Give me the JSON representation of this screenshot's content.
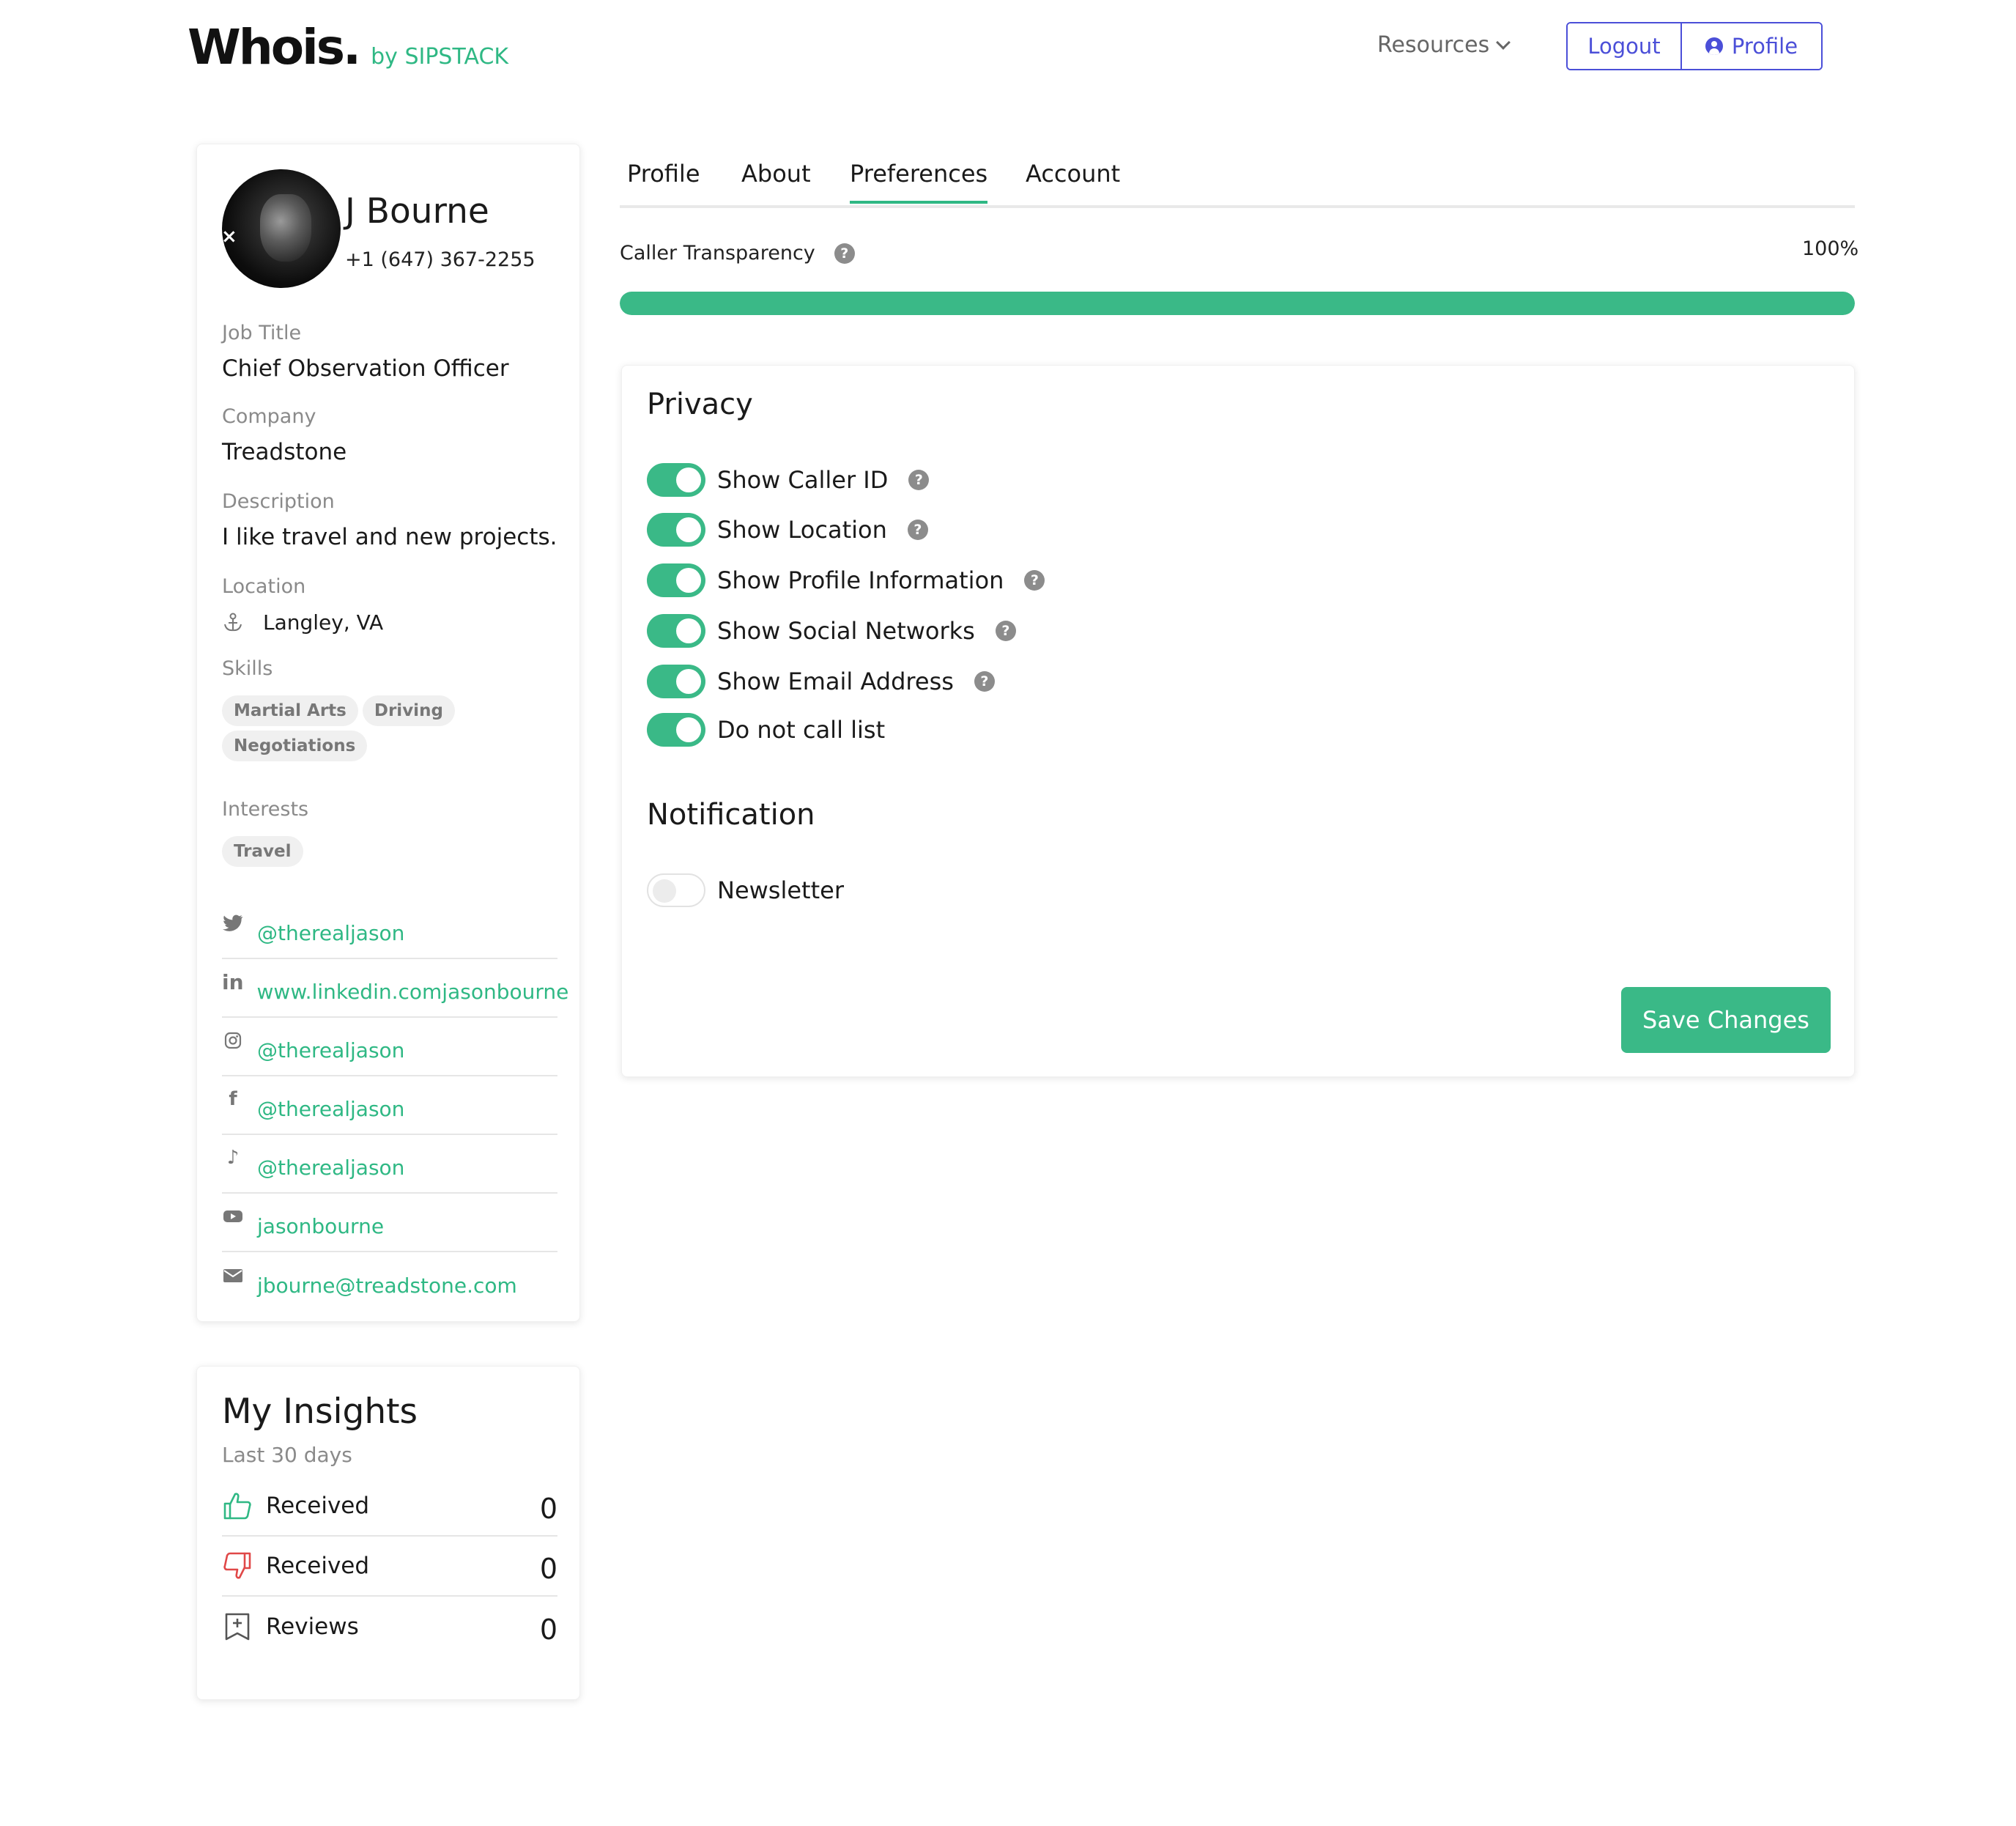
{
  "header": {
    "logo_main": "Whois.",
    "logo_sub": "by SIPSTACK",
    "resources_label": "Resources",
    "logout_label": "Logout",
    "profile_label": "Profile"
  },
  "profile": {
    "name": "J Bourne",
    "phone": "+1 (647) 367-2255",
    "remove_glyph": "×",
    "job_title_label": "Job Title",
    "job_title": "Chief Observation Officer",
    "company_label": "Company",
    "company": "Treadstone",
    "description_label": "Description",
    "description": "I like travel and new projects.",
    "location_label": "Location",
    "location": "Langley, VA",
    "skills_label": "Skills",
    "skills": [
      "Martial Arts",
      "Driving",
      "Negotiations"
    ],
    "interests_label": "Interests",
    "interests": [
      "Travel"
    ],
    "socials": [
      {
        "icon": "twitter-icon",
        "text": "@therealjason"
      },
      {
        "icon": "linkedin-icon",
        "text": "www.linkedin.comjasonbourne"
      },
      {
        "icon": "instagram-icon",
        "text": "@therealjason"
      },
      {
        "icon": "facebook-icon",
        "text": "@therealjason"
      },
      {
        "icon": "tiktok-icon",
        "text": "@therealjason"
      },
      {
        "icon": "youtube-icon",
        "text": "jasonbourne"
      },
      {
        "icon": "email-icon",
        "text": "jbourne@treadstone.com"
      }
    ]
  },
  "insights": {
    "title": "My Insights",
    "subtitle": "Last 30 days",
    "rows": [
      {
        "icon": "thumbs-up-icon",
        "label": "Received",
        "count": "0"
      },
      {
        "icon": "thumbs-down-icon",
        "label": "Received",
        "count": "0"
      },
      {
        "icon": "review-bookmark-icon",
        "label": "Reviews",
        "count": "0"
      }
    ]
  },
  "tabs": [
    "Profile",
    "About",
    "Preferences",
    "Account"
  ],
  "active_tab": "Preferences",
  "transparency": {
    "label": "Caller Transparency",
    "percent_text": "100%",
    "value": 1.0
  },
  "privacy": {
    "title": "Privacy",
    "toggles": [
      {
        "label": "Show Caller ID",
        "on": true,
        "help": true
      },
      {
        "label": "Show Location",
        "on": true,
        "help": true
      },
      {
        "label": "Show Profile Information",
        "on": true,
        "help": true
      },
      {
        "label": "Show Social Networks",
        "on": true,
        "help": true
      },
      {
        "label": "Show Email Address",
        "on": true,
        "help": true
      },
      {
        "label": "Do not call list",
        "on": true,
        "help": false
      }
    ]
  },
  "notification": {
    "title": "Notification",
    "toggles": [
      {
        "label": "Newsletter",
        "on": false,
        "help": false
      }
    ]
  },
  "save_label": "Save Changes",
  "help_glyph": "?",
  "colors": {
    "accent": "#3ab987",
    "link": "#2fb884",
    "button_outline": "#4b4fd8",
    "thumbs_up": "#2fb884",
    "thumbs_down": "#e04848"
  }
}
